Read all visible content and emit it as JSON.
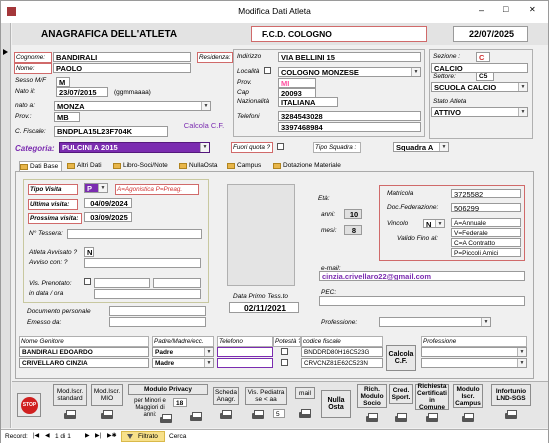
{
  "window": {
    "title": "Modifica Dati Atleta",
    "min": "–",
    "max": "□",
    "close": "✕"
  },
  "header": {
    "title": "ANAGRAFICA DELL'ATLETA",
    "club": "F.C.D. COLOGNO",
    "date": "22/07/2025"
  },
  "person": {
    "cognome_label": "Cognome:",
    "cognome": "BANDIRALI",
    "nome_label": "Nome:",
    "nome": "PAOLO",
    "sesso_label": "Sesso M/F",
    "sesso": "M",
    "nato_il_label": "Nato il:",
    "nato_il": "23/07/2015",
    "date_hint": "(ggmmaaaa)",
    "nato_a_label": "nato a:",
    "nato_a": "MONZA",
    "prov_label": "Prov.:",
    "prov": "MB",
    "cf_label": "C. Fiscale:",
    "cf": "BNDPLA15L23F704K",
    "calcola_cf": "Calcola C.F."
  },
  "residence": {
    "residenza_label": "Residenza:",
    "indirizzo_label": "Indirizzo",
    "indirizzo": "VIA BELLINI 15",
    "localita_label": "Località",
    "localita": "COLOGNO MONZESE",
    "prov_label": "Prov.",
    "prov": "MI",
    "cap_label": "Cap",
    "cap": "20093",
    "nazionalita_label": "Nazionalità",
    "nazionalita": "ITALIANA",
    "telefoni_label": "Telefoni",
    "tel1": "3284543028",
    "tel2": "3397468984"
  },
  "club": {
    "sezione_label": "Sezione :",
    "sezione_code": "C",
    "sezione": "CALCIO",
    "settore_label": "Settore:",
    "settore_code": "C5",
    "settore": "SCUOLA CALCIO",
    "stato_label": "Stato Atleta",
    "stato": "ATTIVO"
  },
  "categoria": {
    "label": "Categoria:",
    "value": "PULCINI A 2015",
    "fuori_quota": "Fuori quota ?",
    "tipo_squadra": "Tipo Squadra :",
    "squadra": "Squadra A"
  },
  "tabs": [
    "Dati Base",
    "Altri Dati",
    "Libro-Soci/Note",
    "NullaOsta",
    "Campus",
    "Dotazione Materiale"
  ],
  "visit": {
    "tipo_label": "Tipo Visita",
    "tipo": "P",
    "agonistica": "A=Agonistica  P=Preag.",
    "ultima_label": "Ultima visita:",
    "ultima": "04/09/2024",
    "prossima_label": "Prossima visita:",
    "prossima": "03/09/2025",
    "tessera_label": "N° Tessera:",
    "avvisato_label": "Atleta Avvisato ?",
    "avvisato": "N",
    "avviso_con_label": "Avviso con: ?",
    "prenotato_label": "Vis. Prenotato:",
    "in_data_label": "in data / ora"
  },
  "age": {
    "eta_label": "Età:",
    "anni_label": "anni:",
    "anni": "10",
    "mesi_label": "mesi:",
    "mesi": "8"
  },
  "tessera": {
    "primo_label": "Data Primo Tess.to",
    "primo": "02/11/2021"
  },
  "federation": {
    "matricola_label": "Matricola",
    "matricola": "3725582",
    "docfed_label": "Doc.Federazione:",
    "docfed": "506299",
    "vincolo_label": "Vincolo",
    "vincolo": "N",
    "valido_label": "Valido Fino al:",
    "legend": [
      "A=Annuale",
      "V=Federale",
      "C=A Contratto",
      "P=Piccoli Amici"
    ]
  },
  "contact": {
    "email_label": "e-mail:",
    "email": "cinzia.crivellaro22@gmail.com",
    "pec_label": "PEC:",
    "professione_label": "Professione:"
  },
  "document": {
    "doc_label": "Documento personale",
    "emesso_label": "Emesso da:"
  },
  "parents": {
    "nome_label": "Nome Genitore",
    "padre_label": "Padre/Madre/ecc.",
    "telefono_label": "Telefono",
    "potesta_label": "Potestà ?",
    "cf_label": "codice fiscale",
    "professione_label": "Professione",
    "rows": [
      {
        "nome": "BANDIRALI EDOARDO",
        "ruolo": "Padre",
        "cf": "BNDDRD80H16C523G"
      },
      {
        "nome": "CRIVELLARO CINZIA",
        "ruolo": "Madre",
        "cf": "CRVCNZ81E62C523N"
      }
    ],
    "calcola": "Calcola C.F."
  },
  "bottom": {
    "iscr_std": "Mod.Iscr. standard",
    "iscr_mio": "Mod.Iscr. MIO",
    "privacy": "Modulo Privacy",
    "privacy_sub": "per Minori e Maggiori di anni:",
    "privacy_age": "18",
    "scheda": "Scheda Anagr.",
    "vis_ped": "Vis. Pediatra se < aa",
    "vis_ped_age": "5",
    "mail": "mail",
    "nulla_osta": "Nulla Osta",
    "rich_socio": "Rich. Modulo Socio",
    "cred_sport": "Cred. Sport.",
    "richiesta": "Richiesta Certificati in Comune",
    "campus": "Modulo Iscr. Campus",
    "infortunio": "Infortunio",
    "lnd": "LND-SGS",
    "stop": "STOP"
  },
  "record": {
    "label": "Record:",
    "pos": "1 di 1",
    "filter": "Filtrato",
    "search": "Cerca"
  },
  "colors": {
    "accent": "#7b2cb0",
    "pink": "#ff4fa0",
    "border_red": "#d06a6a"
  }
}
